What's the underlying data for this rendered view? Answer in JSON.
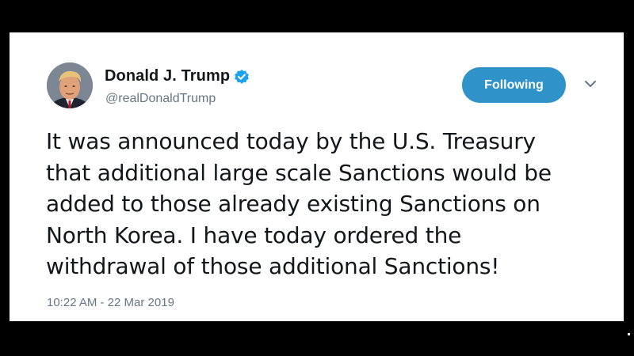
{
  "tweet": {
    "author": {
      "display_name": "Donald J. Trump",
      "handle": "@realDonaldTrump",
      "verified": true,
      "avatar_icon": "profile-photo"
    },
    "follow_button_label": "Following",
    "menu_icon": "chevron-down-icon",
    "text": "It was announced today by the U.S. Treasury\nthat additional large scale Sanctions would be\nadded to those already existing Sanctions on\nNorth Korea. I have today ordered the\nwithdrawal of those additional Sanctions!",
    "timestamp": "10:22 AM - 22 Mar 2019"
  },
  "colors": {
    "accent": "#2f92c8",
    "verified": "#1da1f2",
    "secondary_text": "#657786",
    "primary_text": "#14171a",
    "background": "#000000",
    "card": "#ffffff"
  }
}
